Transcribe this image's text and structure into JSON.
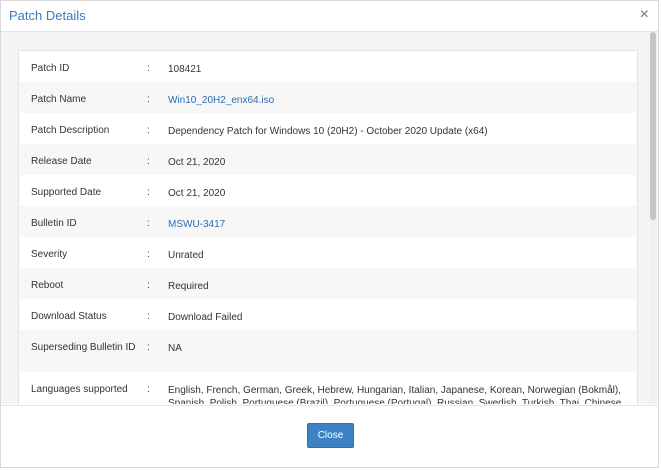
{
  "dialog": {
    "title": "Patch Details",
    "close_glyph": "×",
    "close_button_label": "Close"
  },
  "details": [
    {
      "label": "Patch ID",
      "value": "108421",
      "link": false
    },
    {
      "label": "Patch Name",
      "value": "Win10_20H2_enx64.iso",
      "link": true
    },
    {
      "label": "Patch Description",
      "value": "Dependency Patch for Windows 10 (20H2) - October 2020 Update (x64)",
      "link": false
    },
    {
      "label": "Release Date",
      "value": "Oct 21, 2020",
      "link": false
    },
    {
      "label": "Supported Date",
      "value": "Oct 21, 2020",
      "link": false
    },
    {
      "label": "Bulletin ID",
      "value": "MSWU-3417",
      "link": true
    },
    {
      "label": "Severity",
      "value": "Unrated",
      "link": false
    },
    {
      "label": "Reboot",
      "value": "Required",
      "link": false
    },
    {
      "label": "Download Status",
      "value": "Download Failed",
      "link": false
    },
    {
      "label": "Superseding Bulletin ID",
      "value": "NA",
      "link": false
    },
    {
      "label": "Languages supported",
      "value": "English, French, German, Greek, Hebrew, Hungarian, Italian, Japanese, Korean, Norwegian (Bokmål), Spanish, Polish, Portuguese (Brazil), Portuguese (Portugal), Russian, Swedish, Turkish, Thai, Chinese (Hong",
      "link": false
    }
  ],
  "separator": ":",
  "colors": {
    "title": "#3b7bbf",
    "link": "#2a6db3",
    "button": "#3d82c4"
  }
}
